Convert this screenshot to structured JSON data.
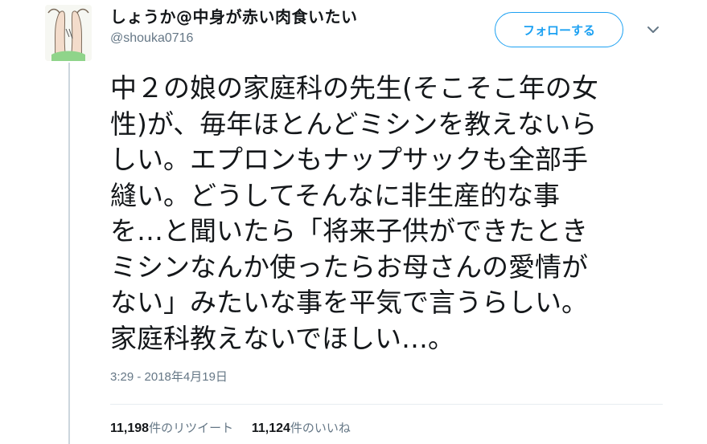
{
  "user": {
    "display_name": "しょうか@中身が赤い肉食いたい",
    "handle": "@shouka0716",
    "avatar_icon": "avatar-illustration-icon"
  },
  "header": {
    "follow_label": "フォローする",
    "menu_icon": "chevron-down-icon"
  },
  "tweet": {
    "lines": [
      "中２の娘の家庭科の先生(そこそこ年の女",
      "性)が、毎年ほとんどミシンを教えないら",
      "しい。エプロンもナップサックも全部手",
      "縫い。どうしてそんなに非生産的な事",
      "を…と聞いたら「将来子供ができたとき",
      "ミシンなんか使ったらお母さんの愛情が",
      "ない」みたいな事を平気で言うらしい。",
      "家庭科教えないでほしい…。"
    ],
    "timestamp": "3:29 - 2018年4月19日"
  },
  "stats": {
    "retweets_count": "11,198",
    "retweets_label": "件のリツイート",
    "likes_count": "11,124",
    "likes_label": "件のいいね"
  },
  "colors": {
    "accent": "#1da1f2",
    "text": "#14171a",
    "muted": "#657786",
    "thread_line": "#ccd6dd"
  }
}
